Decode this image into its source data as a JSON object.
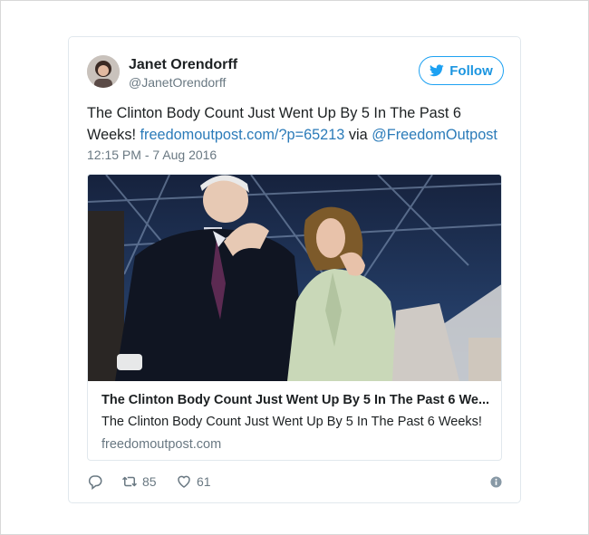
{
  "author": {
    "display_name": "Janet Orendorff",
    "screen_name": "@JanetOrendorff"
  },
  "follow_button": {
    "label": "Follow",
    "icon": "twitter-bird-icon"
  },
  "tweet": {
    "text_before": "The Clinton Body Count Just Went Up By 5 In The Past 6 Weeks! ",
    "link": "freedomoutpost.com/?p=65213",
    "text_via": " via ",
    "mention": "@FreedomOutpost",
    "timestamp": "12:15 PM - 7 Aug 2016"
  },
  "card": {
    "image_icon": "news-photo-image",
    "title": "The Clinton Body Count Just Went Up By 5 In The Past 6 We...",
    "description": "The Clinton Body Count Just Went Up By 5 In The Past 6 Weeks!",
    "domain": "freedomoutpost.com"
  },
  "actions": {
    "reply_icon": "reply-icon",
    "retweet_icon": "retweet-icon",
    "retweet_count": "85",
    "like_icon": "heart-icon",
    "like_count": "61",
    "info_icon": "info-icon"
  },
  "colors": {
    "accent": "#1da1f2",
    "link": "#2b7bb9",
    "muted": "#697882",
    "border": "#e1e8ed"
  }
}
